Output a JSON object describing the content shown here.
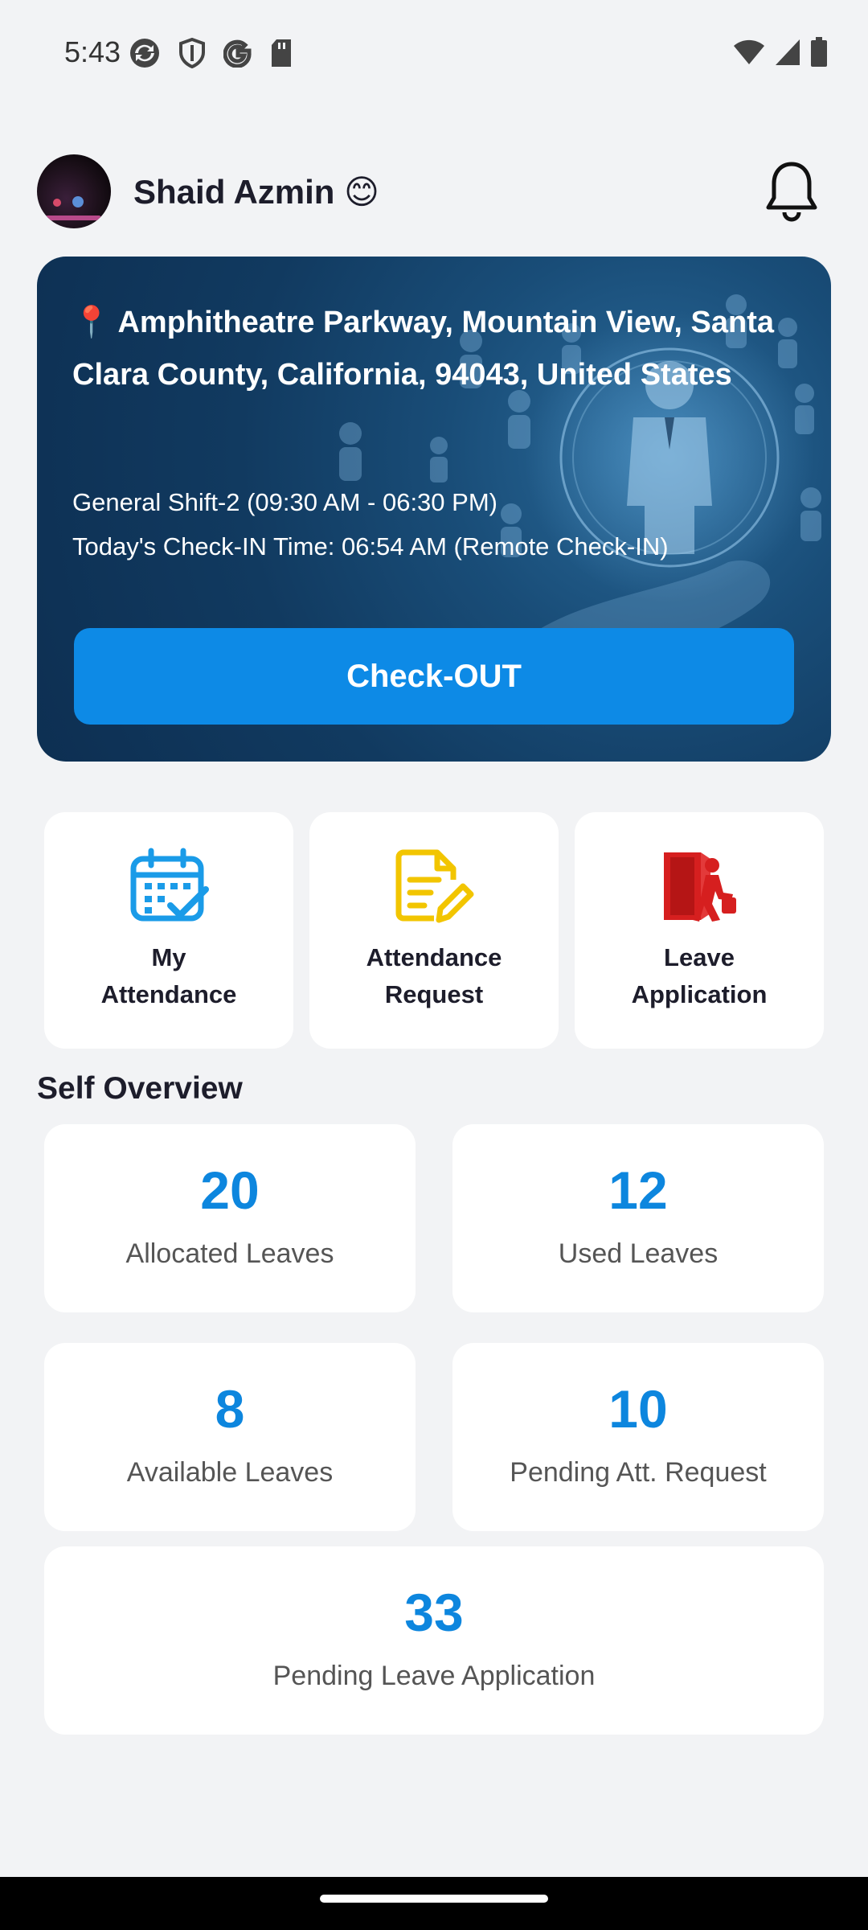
{
  "status_bar": {
    "time": "5:43",
    "left_icons": [
      "sync-icon",
      "shield-icon",
      "google-icon",
      "sd-card-icon"
    ],
    "right_icons": [
      "wifi-icon",
      "signal-icon",
      "battery-icon"
    ]
  },
  "header": {
    "user_name": "Shaid Azmin 😊",
    "notification_icon": "bell-icon"
  },
  "hero": {
    "pin_icon": "📍",
    "address": "Amphitheatre Parkway, Mountain View, Santa Clara County, California, 94043, United States",
    "shift": "General Shift-2 (09:30 AM - 06:30 PM)",
    "checkin": "Today's Check-IN Time: 06:54 AM (Remote Check-IN)",
    "button_label": "Check-OUT",
    "button_color": "#0d8ae6"
  },
  "actions": [
    {
      "label_line1": "My",
      "label_line2": "Attendance",
      "icon": "calendar-check-icon",
      "color": "#1a9be8"
    },
    {
      "label_line1": "Attendance",
      "label_line2": "Request",
      "icon": "edit-document-icon",
      "color": "#f2c500"
    },
    {
      "label_line1": "Leave",
      "label_line2": "Application",
      "icon": "exit-door-icon",
      "color": "#d61f1f"
    }
  ],
  "overview": {
    "title": "Self Overview",
    "accent_color": "#0d86de",
    "stats": [
      {
        "value": "20",
        "label": "Allocated Leaves"
      },
      {
        "value": "12",
        "label": "Used Leaves"
      },
      {
        "value": "8",
        "label": "Available Leaves"
      },
      {
        "value": "10",
        "label": "Pending Att. Request"
      },
      {
        "value": "33",
        "label": "Pending Leave Application"
      }
    ]
  }
}
